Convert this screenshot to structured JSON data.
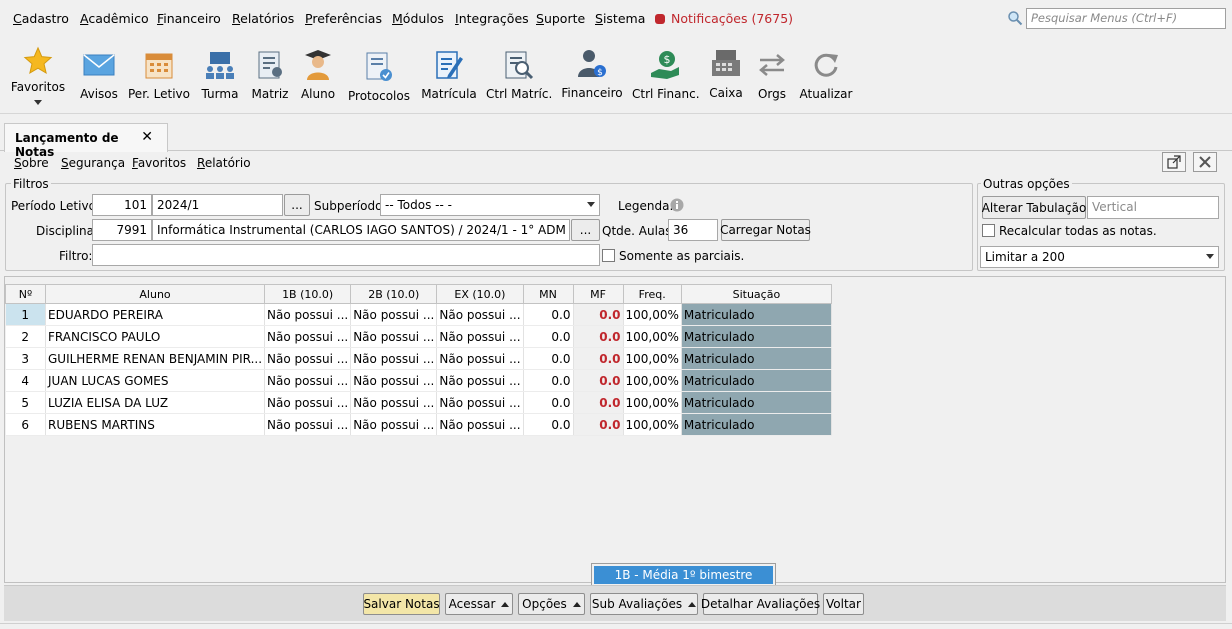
{
  "menu": {
    "items": [
      "Cadastro",
      "Acadêmico",
      "Financeiro",
      "Relatórios",
      "Preferências",
      "Módulos",
      "Integrações",
      "Suporte",
      "Sistema"
    ],
    "notifications": "Notificações (7675)",
    "search_placeholder": "Pesquisar Menus (Ctrl+F)"
  },
  "toolbar": {
    "items": [
      "Favoritos",
      "Avisos",
      "Per. Letivo",
      "Turma",
      "Matriz",
      "Aluno",
      "Protocolos",
      "Matrícula",
      "Ctrl Matríc.",
      "Financeiro",
      "Ctrl Financ.",
      "Caixa",
      "Orgs",
      "Atualizar"
    ]
  },
  "tab": {
    "title": "Lançamento de Notas"
  },
  "submenu": [
    "Sobre",
    "Segurança",
    "Favoritos",
    "Relatório"
  ],
  "filtros": {
    "title": "Filtros",
    "periodo_label": "Período Letivo:",
    "periodo_code": "101",
    "periodo_value": "2024/1",
    "subperiodo_label": "Subperíodo:",
    "subperiodo_value": "-- Todos -- -",
    "legenda_label": "Legenda:",
    "disciplina_label": "Disciplina:",
    "disciplina_code": "7991",
    "disciplina_value": "Informática Instrumental (CARLOS IAGO SANTOS) / 2024/1 - 1° ADM",
    "qtde_label": "Qtde. Aulas:",
    "qtde_value": "36",
    "carregar_label": "Carregar Notas",
    "filtro_label": "Filtro:",
    "filtro_value": "",
    "parciais_label": "Somente as parciais.",
    "ellipsis": "..."
  },
  "outras": {
    "title": "Outras opções",
    "alterar_label": "Alterar Tabulação",
    "vertical_placeholder": "Vertical",
    "recalcular_label": "Recalcular todas as notas.",
    "limitar_value": "Limitar a 200"
  },
  "grid": {
    "columns": [
      "Nº",
      "Aluno",
      "1B (10.0)",
      "2B (10.0)",
      "EX (10.0)",
      "MN",
      "MF",
      "Freq.",
      "Situação"
    ],
    "rows": [
      {
        "n": "1",
        "aluno": "EDUARDO PEREIRA",
        "b1": "Não possui ...",
        "b2": "Não possui ...",
        "ex": "Não possui ...",
        "mn": "0.0",
        "mf": "0.0",
        "freq": "100,00%",
        "sit": "Matriculado"
      },
      {
        "n": "2",
        "aluno": "FRANCISCO PAULO",
        "b1": "Não possui ...",
        "b2": "Não possui ...",
        "ex": "Não possui ...",
        "mn": "0.0",
        "mf": "0.0",
        "freq": "100,00%",
        "sit": "Matriculado"
      },
      {
        "n": "3",
        "aluno": "GUILHERME RENAN BENJAMIN PIR...",
        "b1": "Não possui ...",
        "b2": "Não possui ...",
        "ex": "Não possui ...",
        "mn": "0.0",
        "mf": "0.0",
        "freq": "100,00%",
        "sit": "Matriculado"
      },
      {
        "n": "4",
        "aluno": "JUAN LUCAS GOMES",
        "b1": "Não possui ...",
        "b2": "Não possui ...",
        "ex": "Não possui ...",
        "mn": "0.0",
        "mf": "0.0",
        "freq": "100,00%",
        "sit": "Matriculado"
      },
      {
        "n": "5",
        "aluno": "LUZIA ELISA DA LUZ",
        "b1": "Não possui ...",
        "b2": "Não possui ...",
        "ex": "Não possui ...",
        "mn": "0.0",
        "mf": "0.0",
        "freq": "100,00%",
        "sit": "Matriculado"
      },
      {
        "n": "6",
        "aluno": "RUBENS MARTINS",
        "b1": "Não possui ...",
        "b2": "Não possui ...",
        "ex": "Não possui ...",
        "mn": "0.0",
        "mf": "0.0",
        "freq": "100,00%",
        "sit": "Matriculado"
      }
    ]
  },
  "popup": {
    "item": "1B - Média 1º bimestre"
  },
  "bottom": {
    "salvar": "Salvar Notas",
    "acessar": "Acessar",
    "opcoes": "Opções",
    "sub_avaliacoes": "Sub Avaliações",
    "detalhar": "Detalhar Avaliações",
    "voltar": "Voltar"
  },
  "colors": {
    "notification": "#c0272d",
    "situacao_bg": "#8fa7b0",
    "salvar_bg": "#f3e6a8",
    "popup_highlight": "#3b8fd4"
  }
}
